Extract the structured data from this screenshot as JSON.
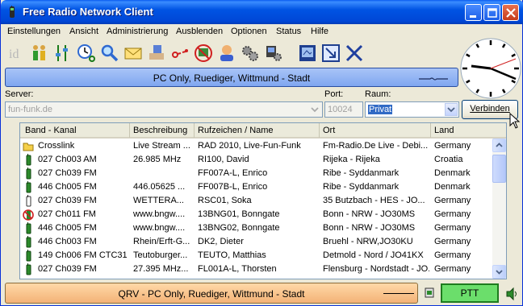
{
  "window": {
    "title": "Free Radio Network Client"
  },
  "menu": [
    "Einstellungen",
    "Ansicht",
    "Administrierung",
    "Ausblenden",
    "Optionen",
    "Status",
    "Hilfe"
  ],
  "toolbar": {
    "icons": [
      "id-icon",
      "people-icon",
      "equalizer-icon",
      "clock-search-icon",
      "magnifier-icon",
      "mail-icon",
      "users-hand-icon",
      "link-icon",
      "no-monitor-icon",
      "person-icon",
      "gears-icon",
      "computer-gear-icon",
      "screen-icon",
      "arrow-screen-icon",
      "close-x-icon"
    ]
  },
  "channel_bar": {
    "text": "PC Only, Ruediger, Wittmund - Stadt",
    "color": "#8fb0f3"
  },
  "connection": {
    "server_label": "Server:",
    "server_value": "fun-funk.de",
    "port_label": "Port:",
    "port_value": "10024",
    "room_label": "Raum:",
    "room_value": "Privat",
    "connect_label": "Verbinden"
  },
  "table": {
    "columns": [
      "Band - Kanal",
      "Beschreibung",
      "Rufzeichen / Name",
      "Ort",
      "Land"
    ],
    "rows": [
      {
        "icon": "folder-icon",
        "band": "Crosslink",
        "desc": "Live Stream ...",
        "call": "RAD 2010, Live-Fun-Funk",
        "ort": "Fm-Radio.De Live - Debi...",
        "land": "Germany"
      },
      {
        "icon": "handset-icon",
        "band": "027 Ch003 AM",
        "desc": "26.985 MHz",
        "call": "RI100, David",
        "ort": "Rijeka - Rijeka",
        "land": "Croatia"
      },
      {
        "icon": "handset-icon",
        "band": "027 Ch039 FM",
        "desc": "",
        "call": "FF007A-L, Enrico",
        "ort": "Ribe - Syddanmark",
        "land": "Denmark"
      },
      {
        "icon": "handset-icon",
        "band": "446 Ch005 FM",
        "desc": "446.05625 ...",
        "call": "FF007B-L, Enrico",
        "ort": "Ribe - Syddanmark",
        "land": "Denmark"
      },
      {
        "icon": "handset-white-icon",
        "band": "027 Ch039 FM",
        "desc": "WETTERA...",
        "call": "RSC01, Soka",
        "ort": "35 Butzbach - HES - JO...",
        "land": "Germany"
      },
      {
        "icon": "forbidden-handset-icon",
        "band": "027 Ch011 FM",
        "desc": "www.bngw....",
        "call": "13BNG01, Bonngate",
        "ort": "Bonn - NRW - JO30MS",
        "land": "Germany"
      },
      {
        "icon": "handset-icon",
        "band": "446 Ch005 FM",
        "desc": "www.bngw....",
        "call": "13BNG02, Bonngate",
        "ort": "Bonn - NRW - JO30MS",
        "land": "Germany"
      },
      {
        "icon": "handset-icon",
        "band": "446 Ch003 FM",
        "desc": "Rhein/Erft-G...",
        "call": "DK2, Dieter",
        "ort": "Bruehl - NRW,JO30KU",
        "land": "Germany"
      },
      {
        "icon": "handset-icon",
        "band": "149 Ch006 FM CTC31",
        "desc": "Teutoburger...",
        "call": "TEUTO, Matthias",
        "ort": "Detmold - Nord / JO41KX",
        "land": "Germany"
      },
      {
        "icon": "handset-icon",
        "band": "027 Ch039 FM",
        "desc": "27.395 MHz...",
        "call": "FL001A-L, Thorsten",
        "ort": "Flensburg - Nordstadt - JO...",
        "land": "Germany"
      }
    ]
  },
  "status_bar": {
    "text": "QRV - PC Only, Ruediger, Wittmund - Stadt",
    "color": "#f6c08a"
  },
  "ptt": {
    "label": "PTT",
    "color": "#6bde6b"
  }
}
